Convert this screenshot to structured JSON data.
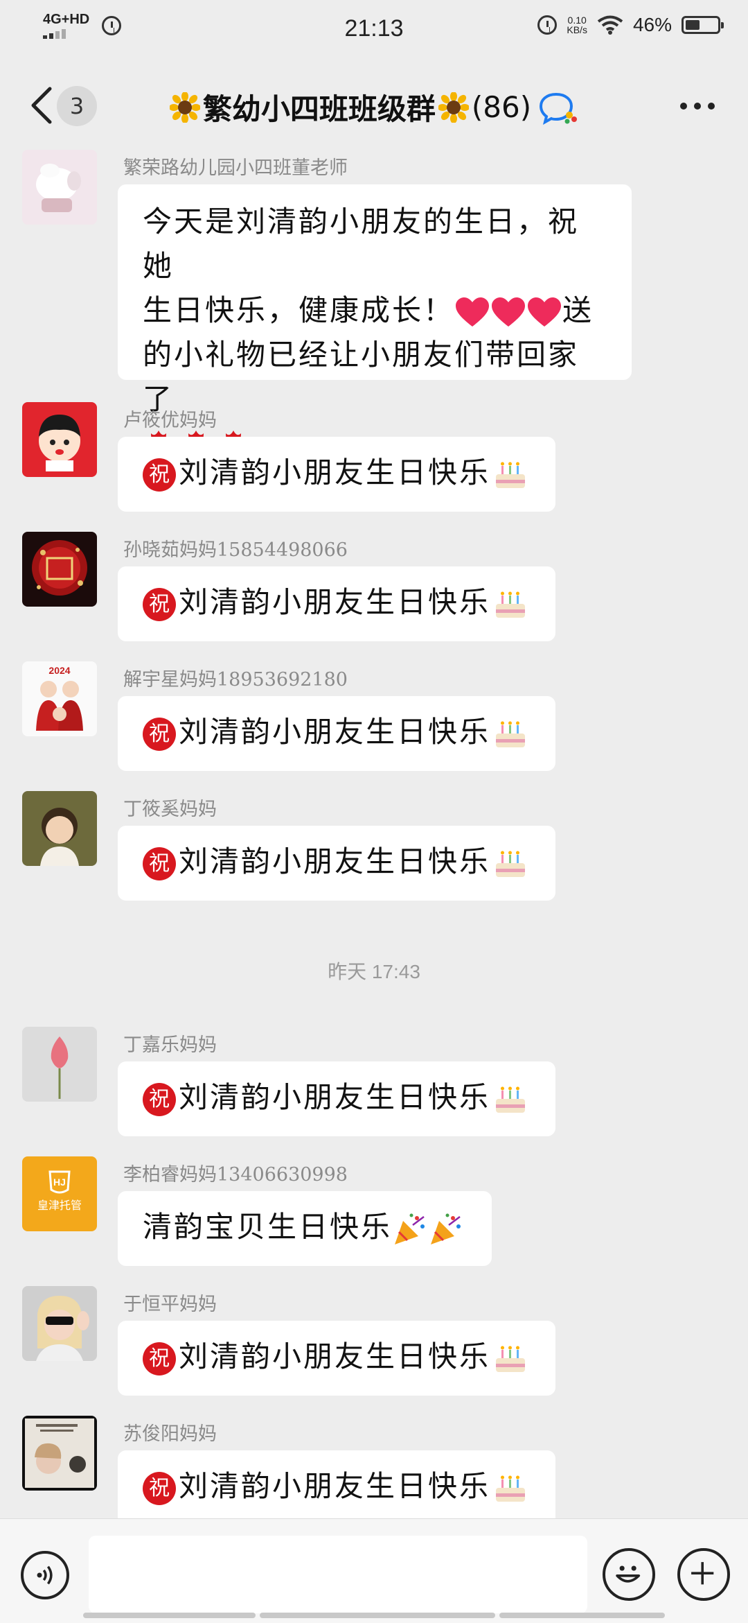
{
  "status": {
    "network": "4G+HD",
    "time": "21:13",
    "speed_value": "0.10",
    "speed_unit": "KB/s",
    "battery": "46%"
  },
  "header": {
    "unread": "3",
    "title": "繁幼小四班班级群",
    "count": "(86)"
  },
  "messages": [
    {
      "sender": "繁荣路幼儿园小四班董老师",
      "line1": "今天是刘清韵小朋友的生日，祝她",
      "line2": "生日快乐，健康成长！",
      "line2b": "送",
      "line3": "的小礼物已经让小朋友们带回家了"
    },
    {
      "sender": "卢筱优妈妈",
      "text": "刘清韵小朋友生日快乐"
    },
    {
      "sender": "孙晓茹妈妈15854498066",
      "text": "刘清韵小朋友生日快乐"
    },
    {
      "sender": "解宇星妈妈18953692180",
      "text": "刘清韵小朋友生日快乐"
    },
    {
      "sender": "丁筱奚妈妈",
      "text": "刘清韵小朋友生日快乐"
    },
    {
      "sender": "丁嘉乐妈妈",
      "text": "刘清韵小朋友生日快乐"
    },
    {
      "sender": "李柏睿妈妈13406630998",
      "text": "清韵宝贝生日快乐"
    },
    {
      "sender": "于恒平妈妈",
      "text": "刘清韵小朋友生日快乐"
    },
    {
      "sender": "苏俊阳妈妈",
      "text": "刘清韵小朋友生日快乐"
    }
  ],
  "timestamp": "昨天 17:43",
  "badge_char": "祝",
  "avatar_texts": {
    "tiger": "2024",
    "sun_logo": "HJ",
    "sun_brand": "皇津托管"
  },
  "colors": {
    "background": "#ededed",
    "bubble": "#ffffff",
    "badge_red": "#d8181f",
    "sender_gray": "#8a8a8a"
  }
}
